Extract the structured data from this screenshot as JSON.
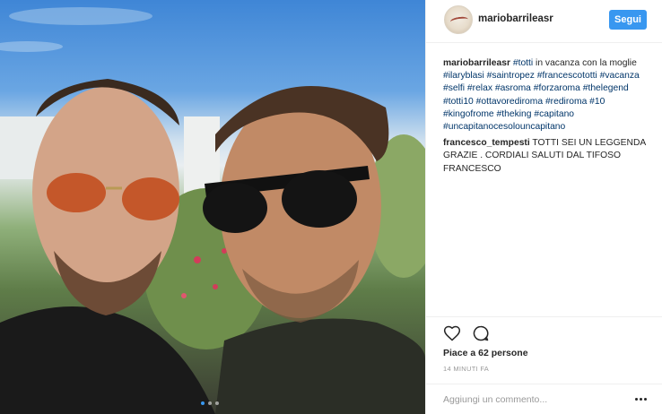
{
  "post": {
    "author": "mariobarrileasr",
    "follow_label": "Segui",
    "caption": {
      "author": "mariobarrileasr",
      "parts": [
        {
          "type": "tag",
          "text": "#totti"
        },
        {
          "type": "text",
          "text": " in vacanza con la moglie "
        },
        {
          "type": "tag",
          "text": "#ilaryblasi"
        },
        {
          "type": "text",
          "text": " "
        },
        {
          "type": "tag",
          "text": "#saintropez"
        },
        {
          "type": "text",
          "text": " "
        },
        {
          "type": "tag",
          "text": "#francescototti"
        },
        {
          "type": "text",
          "text": " "
        },
        {
          "type": "tag",
          "text": "#vacanza"
        },
        {
          "type": "text",
          "text": " "
        },
        {
          "type": "tag",
          "text": "#selfi"
        },
        {
          "type": "text",
          "text": " "
        },
        {
          "type": "tag",
          "text": "#relax"
        },
        {
          "type": "text",
          "text": " "
        },
        {
          "type": "tag",
          "text": "#asroma"
        },
        {
          "type": "text",
          "text": " "
        },
        {
          "type": "tag",
          "text": "#forzaroma"
        },
        {
          "type": "text",
          "text": " "
        },
        {
          "type": "tag",
          "text": "#thelegend"
        },
        {
          "type": "text",
          "text": " "
        },
        {
          "type": "tag",
          "text": "#totti10"
        },
        {
          "type": "text",
          "text": " "
        },
        {
          "type": "tag",
          "text": "#ottavorediroma"
        },
        {
          "type": "text",
          "text": " "
        },
        {
          "type": "tag",
          "text": "#rediroma"
        },
        {
          "type": "text",
          "text": " "
        },
        {
          "type": "tag",
          "text": "#10"
        },
        {
          "type": "text",
          "text": " "
        },
        {
          "type": "tag",
          "text": "#kingofrome"
        },
        {
          "type": "text",
          "text": " "
        },
        {
          "type": "tag",
          "text": "#theking"
        },
        {
          "type": "text",
          "text": " "
        },
        {
          "type": "tag",
          "text": "#capitano"
        },
        {
          "type": "text",
          "text": " "
        },
        {
          "type": "tag",
          "text": "#uncapitanocesolouncapitano"
        }
      ]
    },
    "comment": {
      "author": "francesco_tempesti",
      "text": "TOTTI SEI UN LEGGENDA GRAZIE . CORDIALI SALUTI DAL TIFOSO FRANCESCO"
    },
    "likes_label": "Piace a 62 persone",
    "time_label": "14 MINUTI FA",
    "add_comment_placeholder": "Aggiungi un commento...",
    "carousel": {
      "count": 3,
      "active": 1
    }
  },
  "colors": {
    "accent": "#3897f0",
    "tag": "#003569",
    "border": "#efefef"
  },
  "icons": [
    "heart-icon",
    "comment-icon",
    "more-options-icon"
  ]
}
